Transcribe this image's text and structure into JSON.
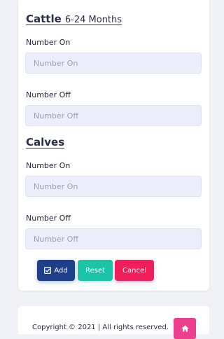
{
  "cattle": {
    "title_main": "Cattle",
    "title_sub": "6-24 Months",
    "number_on_label": "Number On",
    "number_on_placeholder": "Number On",
    "number_on_value": "",
    "number_off_label": "Number Off",
    "number_off_placeholder": "Number Off",
    "number_off_value": ""
  },
  "calves": {
    "title": "Calves",
    "number_on_label": "Number On",
    "number_on_placeholder": "Number On",
    "number_on_value": "",
    "number_off_label": "Number Off",
    "number_off_placeholder": "Number Off",
    "number_off_value": ""
  },
  "actions": {
    "add_icon": "check-square-icon",
    "add_label": "Add",
    "reset_label": "Reset",
    "cancel_label": "Cancel"
  },
  "footer": {
    "copyright": "Copyright © 2021 | All rights reserved.",
    "home_icon": "home-icon"
  },
  "colors": {
    "add": "#1d3f8c",
    "reset": "#1cc3a7",
    "cancel": "#f01f5b",
    "home": "#ee3f8e",
    "input_bg": "#eceefb"
  }
}
